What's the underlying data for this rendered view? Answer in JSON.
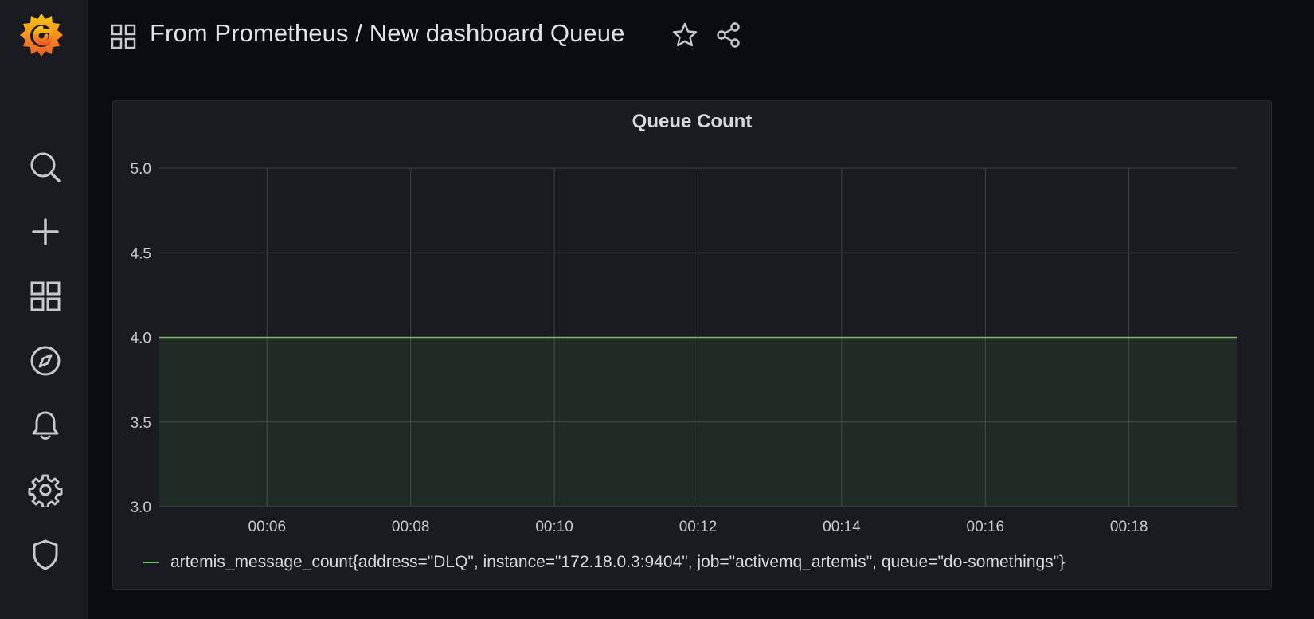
{
  "sidebar": {
    "items": [
      {
        "icon": "search-icon"
      },
      {
        "icon": "plus-icon"
      },
      {
        "icon": "dashboards-icon"
      },
      {
        "icon": "compass-icon"
      },
      {
        "icon": "bell-icon"
      },
      {
        "icon": "gear-icon"
      },
      {
        "icon": "shield-icon"
      }
    ]
  },
  "header": {
    "title": "From Prometheus / New dashboard Queue"
  },
  "colors": {
    "series": "#73bf69",
    "background": "#0b0c0e",
    "panel": "#181b1f",
    "grid": "#3d4045"
  },
  "panel": {
    "title": "Queue Count"
  },
  "chart_data": {
    "type": "area",
    "title": "Queue Count",
    "x_ticks": [
      "00:06",
      "00:08",
      "00:10",
      "00:12",
      "00:14",
      "00:16",
      "00:18"
    ],
    "y_ticks": [
      "3.0",
      "3.5",
      "4.0",
      "4.5",
      "5.0"
    ],
    "ylim": [
      3.0,
      5.0
    ],
    "xlim": [
      "00:04:30",
      "00:19:30"
    ],
    "grid": true,
    "legend_position": "bottom-left",
    "series": [
      {
        "name": "artemis_message_count{address=\"DLQ\", instance=\"172.18.0.3:9404\", job=\"activemq_artemis\", queue=\"do-somethings\"}",
        "x": [
          "00:04:30",
          "00:19:30"
        ],
        "values": [
          4.0,
          4.0
        ]
      }
    ]
  }
}
